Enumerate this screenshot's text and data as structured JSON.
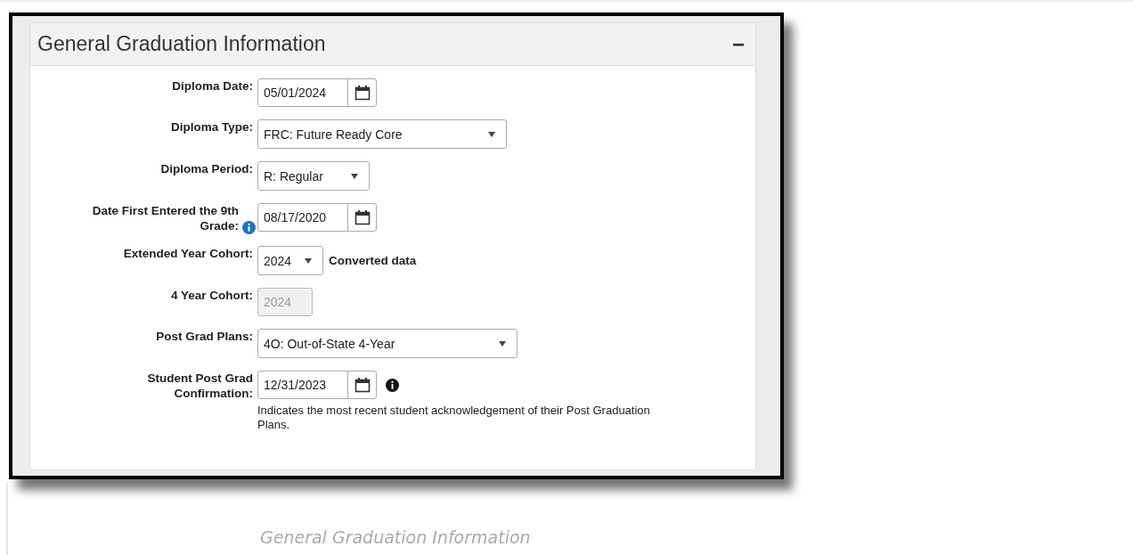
{
  "panel": {
    "title": "General Graduation Information",
    "collapse_glyph": "−"
  },
  "fields": [
    {
      "label": "Diploma Date:",
      "kind": "date",
      "value": "05/01/2024"
    },
    {
      "label": "Diploma Type:",
      "kind": "select",
      "value": "FRC: Future Ready Core"
    },
    {
      "label": "Diploma Period:",
      "kind": "select",
      "value": "R: Regular"
    },
    {
      "label": "Date First Entered the 9th Grade:",
      "kind": "date",
      "value": "08/17/2020",
      "label_info": true
    },
    {
      "label": "Extended Year Cohort:",
      "kind": "select",
      "value": "2024",
      "suffix": "Converted data"
    },
    {
      "label": "4 Year Cohort:",
      "kind": "readonly",
      "value": "2024"
    },
    {
      "label": "Post Grad Plans:",
      "kind": "select",
      "value": "4O: Out-of-State 4-Year"
    },
    {
      "label": "Student Post Grad Confirmation:",
      "kind": "date",
      "value": "12/31/2023",
      "info_after": true,
      "note": "Indicates the most recent student acknowledgement of their Post Graduation Plans."
    }
  ],
  "caption": "General Graduation Information"
}
